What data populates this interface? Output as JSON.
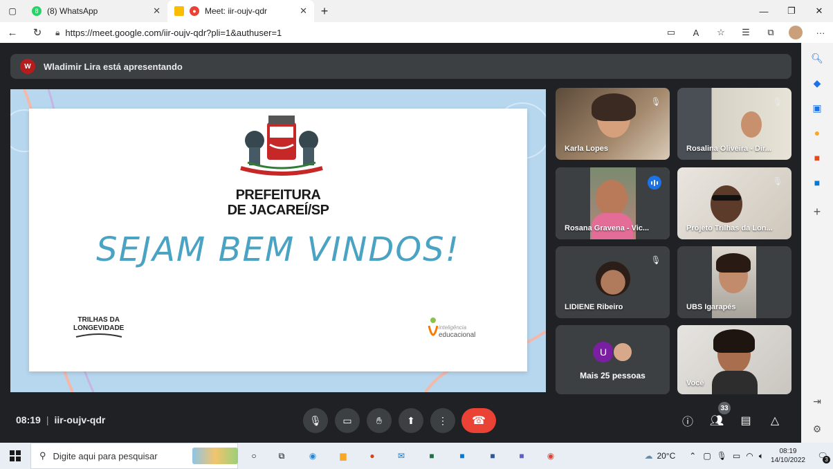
{
  "browser": {
    "tabs": [
      {
        "title": "(8) WhatsApp",
        "badge": "8"
      },
      {
        "title": "Meet: iir-oujv-qdr"
      }
    ],
    "url": "https://meet.google.com/iir-oujv-qdr?pli=1&authuser=1"
  },
  "meet": {
    "presenting_text": "Wladimir Lira está apresentando",
    "slide": {
      "title_line1": "PREFEITURA",
      "title_line2": "DE JACAREÍ/SP",
      "welcome": "SEJAM BEM VINDOS!",
      "logo_left_line1": "TRILHAS DA",
      "logo_left_line2": "LONGEVIDADE",
      "logo_right_small": "inteligência",
      "logo_right_main": "educacional"
    },
    "participants": [
      {
        "name": "Karla Lopes"
      },
      {
        "name": "Rosalina Oliveira - Dir..."
      },
      {
        "name": "Rosana Gravena - Vic..."
      },
      {
        "name": "Projeto Trilhas da Lon..."
      },
      {
        "name": "LIDIENE Ribeiro"
      },
      {
        "name": "UBS Igarapés"
      },
      {
        "name": "Mais 25 pessoas",
        "avatar_letter": "U"
      },
      {
        "name": "Você"
      }
    ],
    "bottom": {
      "time": "08:19",
      "code": "iir-oujv-qdr",
      "participants_count": "33"
    }
  },
  "taskbar": {
    "search_placeholder": "Digite aqui para pesquisar",
    "temperature": "20°C",
    "time": "08:19",
    "date": "14/10/2022",
    "notifications": "3"
  },
  "colors": {
    "accent": "#1a73e8",
    "hangup": "#ea4335",
    "welcome_text": "#4ba3c3"
  }
}
